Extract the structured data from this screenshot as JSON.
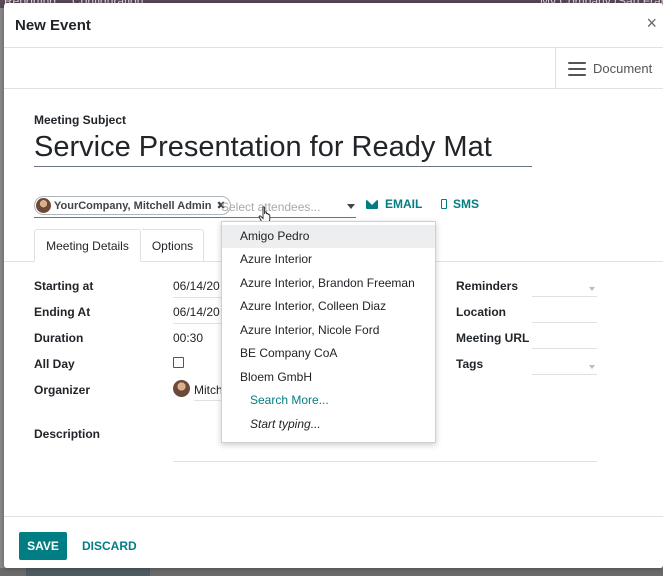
{
  "background": {
    "menu_items": [
      "Reporting",
      "Configuration"
    ],
    "company_label": "My Company (San Francisco)"
  },
  "dialog": {
    "title": "New Event",
    "close_symbol": "×",
    "document_button": "Document"
  },
  "form": {
    "subject_label": "Meeting Subject",
    "subject_value": "Service Presentation for Ready Mat",
    "attendees": [
      {
        "name": "YourCompany, Mitchell Admin"
      }
    ],
    "attendee_remove_symbol": "✖",
    "attendee_placeholder": "Select attendees...",
    "email_label": "EMAIL",
    "sms_label": "SMS"
  },
  "tabs": [
    {
      "label": "Meeting Details",
      "active": true
    },
    {
      "label": "Options",
      "active": false
    }
  ],
  "fields": {
    "starting_at": {
      "label": "Starting at",
      "value": "06/14/20"
    },
    "ending_at": {
      "label": "Ending At",
      "value": "06/14/20"
    },
    "duration": {
      "label": "Duration",
      "value": "00:30"
    },
    "all_day": {
      "label": "All Day",
      "checked": false
    },
    "organizer": {
      "label": "Organizer",
      "value": "Mitch"
    },
    "description": {
      "label": "Description"
    },
    "reminders": {
      "label": "Reminders"
    },
    "location": {
      "label": "Location"
    },
    "meeting_url": {
      "label": "Meeting URL"
    },
    "tags": {
      "label": "Tags"
    }
  },
  "dropdown": {
    "items": [
      "Amigo Pedro",
      "Azure Interior",
      "Azure Interior, Brandon Freeman",
      "Azure Interior, Colleen Diaz",
      "Azure Interior, Nicole Ford",
      "BE Company CoA",
      "Bloem GmbH"
    ],
    "highlighted_index": 0,
    "search_more": "Search More...",
    "start_typing": "Start typing..."
  },
  "footer": {
    "save_label": "SAVE",
    "discard_label": "DISCARD"
  },
  "colors": {
    "accent": "#017e84",
    "text": "#212529",
    "border": "#dee2e6",
    "highlight": "#eceeef"
  }
}
